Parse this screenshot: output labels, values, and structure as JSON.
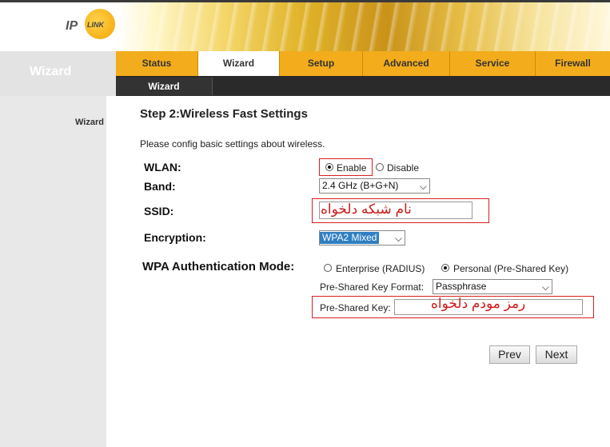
{
  "brand": {
    "logo_text": "IP",
    "logo_sub": "LINK"
  },
  "sidebar": {
    "title": "Wizard",
    "item": "Wizard"
  },
  "nav": {
    "tabs": [
      "Status",
      "Wizard",
      "Setup",
      "Advanced",
      "Service",
      "Firewall"
    ],
    "active_tab": "Wizard",
    "subtab": "Wizard"
  },
  "main": {
    "title": "Step 2:Wireless Fast Settings",
    "intro": "Please config basic settings about wireless.",
    "wlan": {
      "label": "WLAN:",
      "enable": "Enable",
      "disable": "Disable",
      "selected": "Enable"
    },
    "band": {
      "label": "Band:",
      "value": "2.4 GHz (B+G+N)"
    },
    "ssid": {
      "label": "SSID:",
      "value": "نام شبکه دلخواه"
    },
    "encryption": {
      "label": "Encryption:",
      "value": "WPA2 Mixed"
    },
    "wpa_mode": {
      "label": "WPA Authentication Mode:",
      "enterprise": "Enterprise (RADIUS)",
      "personal": "Personal (Pre-Shared Key)",
      "selected": "Personal (Pre-Shared Key)"
    },
    "psk_format": {
      "label": "Pre-Shared Key Format:",
      "value": "Passphrase"
    },
    "psk": {
      "label": "Pre-Shared Key:",
      "value": "رمز مودم دلخواه"
    },
    "buttons": {
      "prev": "Prev",
      "next": "Next"
    }
  },
  "colors": {
    "tab_orange": "#f3ac1c",
    "annotation_red": "#d82020",
    "encryption_highlight": "#2f7fc1"
  }
}
